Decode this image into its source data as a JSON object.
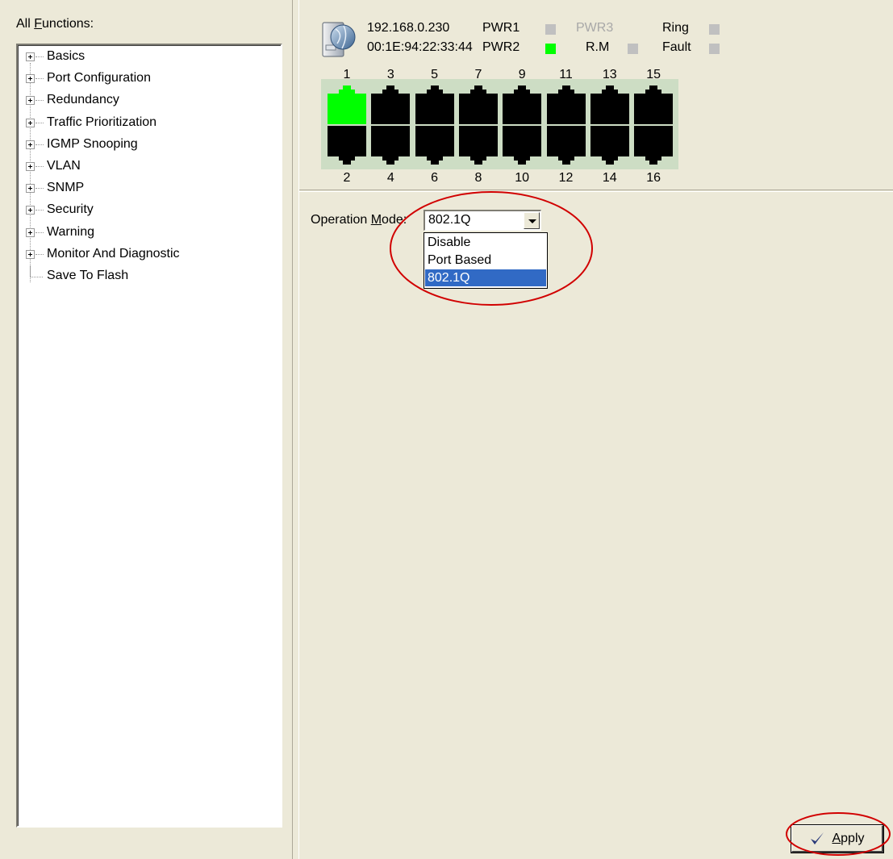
{
  "left_pane": {
    "label": "All Functions:",
    "label_accel": "F",
    "tree_items": [
      {
        "label": "Basics",
        "expandable": true
      },
      {
        "label": "Port Configuration",
        "expandable": true
      },
      {
        "label": "Redundancy",
        "expandable": true
      },
      {
        "label": "Traffic Prioritization",
        "expandable": true
      },
      {
        "label": "IGMP Snooping",
        "expandable": true
      },
      {
        "label": "VLAN",
        "expandable": true
      },
      {
        "label": "SNMP",
        "expandable": true
      },
      {
        "label": "Security",
        "expandable": true
      },
      {
        "label": "Warning",
        "expandable": true
      },
      {
        "label": "Monitor And Diagnostic",
        "expandable": true
      },
      {
        "label": "Save To Flash",
        "expandable": false
      }
    ]
  },
  "status": {
    "ip": "192.168.0.230",
    "mac": "00:1E:94:22:33:44",
    "indicators": [
      {
        "label": "PWR1",
        "state": "off"
      },
      {
        "label": "PWR2",
        "state": "on"
      },
      {
        "label": "PWR3",
        "state": "disabled"
      },
      {
        "label": "R.M",
        "state": "off"
      },
      {
        "label": "Ring",
        "state": "off"
      },
      {
        "label": "Fault",
        "state": "off"
      }
    ],
    "ports_top": [
      "1",
      "3",
      "5",
      "7",
      "9",
      "11",
      "13",
      "15"
    ],
    "ports_bottom": [
      "2",
      "4",
      "6",
      "8",
      "10",
      "12",
      "14",
      "16"
    ],
    "active_ports": [
      "1"
    ],
    "colors": {
      "port_active": "#00ff00",
      "port_idle": "#000000",
      "led_on": "#00ff00",
      "led_off": "#c0c0c0"
    }
  },
  "vlan": {
    "op_mode_label_before": "Operation ",
    "op_mode_label_accel": "M",
    "op_mode_label_after": "ode:",
    "selected_value": "802.1Q",
    "options": [
      "Disable",
      "Port Based",
      "802.1Q"
    ],
    "highlighted_option": "802.1Q"
  },
  "apply_button": {
    "accel": "A",
    "rest": "pply",
    "icon": "checkmark-icon"
  },
  "colors": {
    "annotation": "#d10000",
    "selection": "#316ac5",
    "background": "#ece9d8"
  }
}
